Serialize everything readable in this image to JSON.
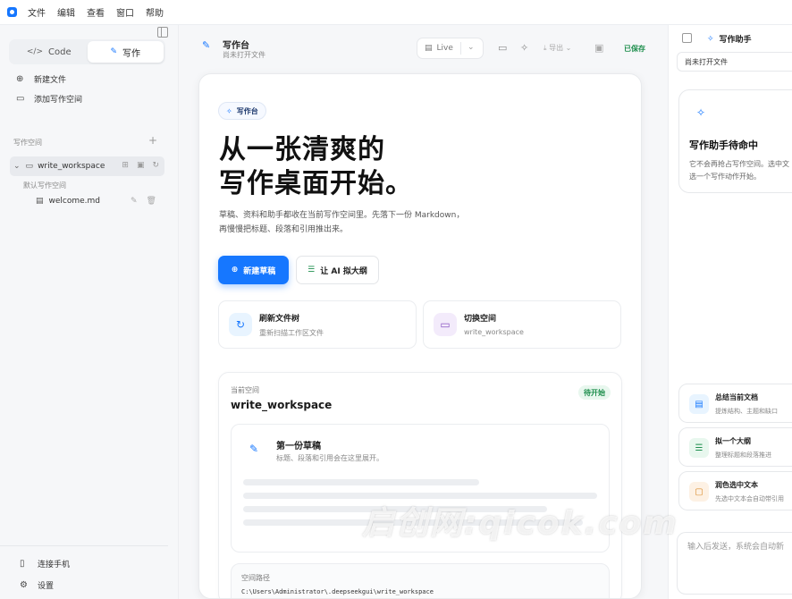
{
  "menubar": {
    "items": [
      "文件",
      "编辑",
      "查看",
      "窗口",
      "帮助"
    ]
  },
  "sidebar": {
    "mode_tabs": {
      "code": "Code",
      "write": "写作",
      "code_icon": "code-icon",
      "write_icon": "pen-icon"
    },
    "actions": {
      "new_file": "新建文件",
      "add_workspace": "添加写作空间"
    },
    "section_title": "写作空间",
    "workspace": {
      "name": "write_workspace",
      "default_label": "默认写作空间"
    },
    "file": {
      "name": "welcome.md"
    },
    "bottom": {
      "connect_phone": "连接手机",
      "settings": "设置"
    }
  },
  "header": {
    "title": "写作台",
    "subtitle": "尚未打开文件",
    "mode": "Live",
    "export": "导出",
    "status": "已保存",
    "status_color": "#1f8f4e"
  },
  "main": {
    "badge": "写作台",
    "hero_line1": "从一张清爽的",
    "hero_line2": "写作桌面开始。",
    "desc_line1": "草稿、资料和助手都收在当前写作空间里。先落下一份 Markdown，",
    "desc_line2": "再慢慢把标题、段落和引用推出来。",
    "primary_button": "新建草稿",
    "secondary_button": "让 AI 拟大纲",
    "accent": "#1677ff",
    "quick": [
      {
        "title": "刷新文件树",
        "subtitle": "重新扫描工作区文件",
        "icon": "refresh-icon"
      },
      {
        "title": "切换空间",
        "subtitle": "write_workspace",
        "icon": "folder-icon"
      }
    ],
    "workspace_card": {
      "label": "当前空间",
      "name": "write_workspace",
      "status": "待开始",
      "draft_title": "第一份草稿",
      "draft_subtitle": "标题、段落和引用会在这里展开。",
      "path_label": "空间路径",
      "path_value": "C:\\Users\\Administrator\\.deepseekgui\\write_workspace"
    }
  },
  "assistant": {
    "title": "写作助手",
    "file_select": "尚未打开文件",
    "idle_title": "写作助手待命中",
    "idle_desc_line1": "它不会再抢占写作空间。选中文",
    "idle_desc_line2": "选一个写作动作开始。",
    "actions": [
      {
        "title": "总结当前文档",
        "subtitle": "提炼结构、主题和缺口",
        "icon": "doc-icon"
      },
      {
        "title": "拟一个大纲",
        "subtitle": "整理标题和段落推进",
        "icon": "list-icon"
      },
      {
        "title": "润色选中文本",
        "subtitle": "先选中文本会自动带引用",
        "icon": "chat-icon"
      }
    ],
    "input_placeholder": "输入后发送，系统会自动新"
  },
  "watermark": "启创网:qicok.com"
}
